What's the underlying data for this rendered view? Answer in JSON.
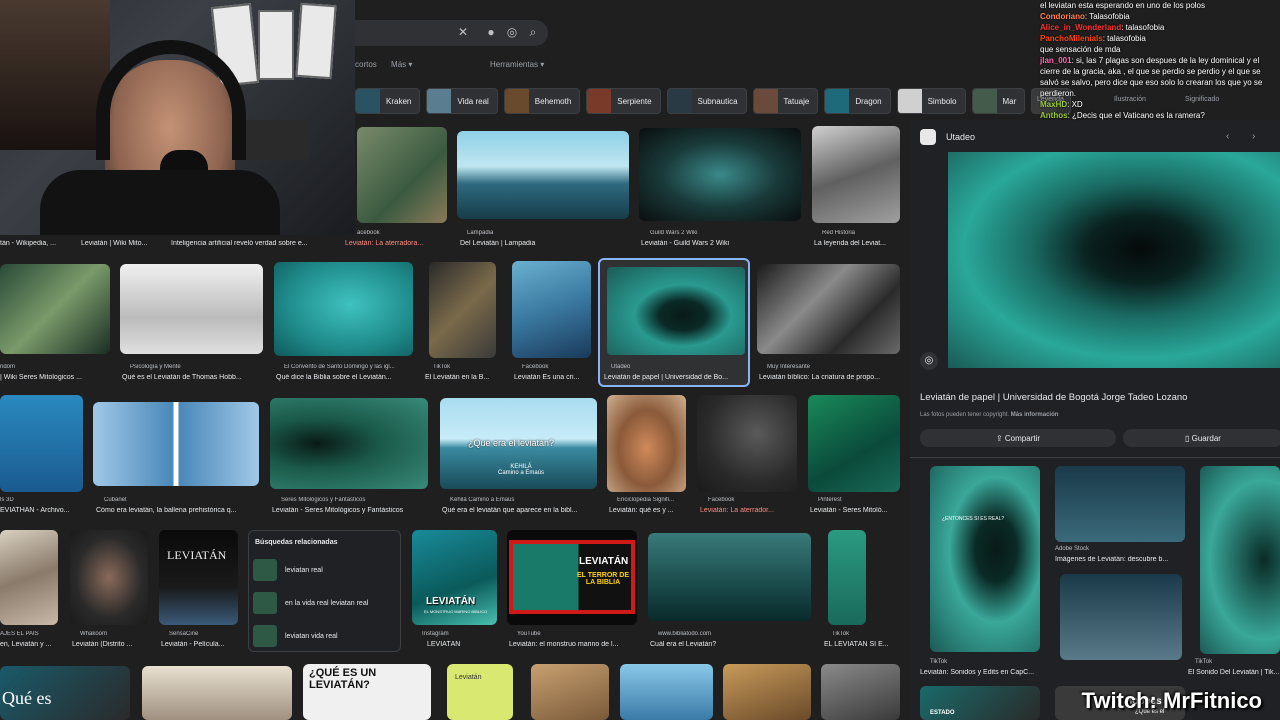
{
  "search": {
    "tabs": [
      "cortos",
      "Más ▾"
    ],
    "tools": "Herramientas ▾"
  },
  "chips": [
    "Kraken",
    "Vida real",
    "Behemoth",
    "Serpiente",
    "Subnautica",
    "Tatuaje",
    "Dragon",
    "Simbolo",
    "Mar"
  ],
  "chip_colors": [
    "#2b5260",
    "#5b7d90",
    "#6a4a2c",
    "#7a3a2a",
    "#2a3a44",
    "#6a4a3a",
    "#1f6a7a",
    "#d0d0d0",
    "#445a4a"
  ],
  "row1": [
    {
      "src": "acebook",
      "title": "Leviatán: La aterradora..."
    },
    {
      "src": "Lampadia",
      "title": "Del Leviatán | Lampadia"
    },
    {
      "src": "Guild Wars 2 Wiki",
      "title": "Leviatán - Guild Wars 2 Wiki"
    },
    {
      "src": "Red Historia",
      "title": "La leyenda del Leviat..."
    },
    {
      "src": "",
      "title": "tán - Wikipedia, ..."
    },
    {
      "src": "",
      "title": "Leviatán | Wiki Mito..."
    },
    {
      "src": "",
      "title": "Inteligencia artificial reveló verdad sobre e..."
    }
  ],
  "row2": [
    {
      "src": "ndom",
      "title": "| Wiki Seres Mitologicos ..."
    },
    {
      "src": "Psicología y Mente",
      "title": "Qué es el Leviatán de Thomas Hobb..."
    },
    {
      "src": "El Convento de Santo Domingo y las igl...",
      "title": "Qué dice la Biblia sobre el Leviatán..."
    },
    {
      "src": "TikTok",
      "title": "El Leviatán en la B..."
    },
    {
      "src": "Facebook",
      "title": "Leviatán Es una cri..."
    },
    {
      "src": "Utadeo",
      "title": "Leviatán de papel | Universidad de Bo..."
    },
    {
      "src": "Muy Interesante",
      "title": "Leviatán bíblico: La criatura de propo..."
    }
  ],
  "row3": [
    {
      "src": "ls 3D",
      "title": "EVIATHAN - Archivo..."
    },
    {
      "src": "Cubanet",
      "title": "Cómo era leviatán, la ballena prehistórica q..."
    },
    {
      "src": "Seres Mitológicos y Fantásticos",
      "title": "Leviatán - Seres Mitológicos y Fantásticos"
    },
    {
      "src": "Kehilá Camino a Emaús",
      "title": "Qué era el leviatán que aparece en la bibl..."
    },
    {
      "src": "Enciclopedia Signifi...",
      "title": "Leviatán: qué es y ..."
    },
    {
      "src": "Facebook",
      "title": "Leviatán: La aterrador..."
    },
    {
      "src": "Pinterest",
      "title": "Leviatán - Seres Mitoló..."
    }
  ],
  "row4": [
    {
      "src": "AJES EL PAIS",
      "title": "en, Leviatán y ..."
    },
    {
      "src": "Whakoom",
      "title": "Leviatán (Distrito ..."
    },
    {
      "src": "SensaCine",
      "title": "Leviatán - Película..."
    },
    {
      "src": "Instagram",
      "title": "LEVIATÁN"
    },
    {
      "src": "YouTube",
      "title": "Leviatán: el monstruo marino de l..."
    },
    {
      "src": "www.bibliatodo.com",
      "title": "Cuál era el Leviatán?"
    },
    {
      "src": "TikTok",
      "title": "EL LEVIATÁN SÍ E..."
    }
  ],
  "overlay_text": {
    "que_era": "¿Que era el leviatán?",
    "kehila": "KEHILÁ\nCamino a Emaús",
    "leviatan_poster": "LEVIATÁN",
    "leviatan_green": "LEVIATÁN",
    "el_monstruo": "EL MONSTRUO MARINO BÍBLICO",
    "red_title": "LEVIATÁN",
    "red_sub": "EL TERROR DE LA BIBLIA",
    "que_es_bottom": "¿QUÉ ES UN LEVIATÁN?",
    "que_es_left": "Qué es",
    "leviatan_book": "Leviatán",
    "entonces": "¿ENTONCES SI ES REAL?",
    "hobbes": "Hobbes",
    "hobbes_sub": "¿Qué es el",
    "estado": "ESTADO"
  },
  "related": {
    "title": "Búsquedas relacionadas",
    "items": [
      "leviatan real",
      "en la vida real leviatan real",
      "leviatan vida real"
    ]
  },
  "panel": {
    "source": "Utadeo",
    "title": "Leviatán de papel | Universidad de Bogotá Jorge Tadeo Lozano",
    "copyright": "Las fotos pueden tener copyright.",
    "more_info": "Más información",
    "share": "Compartir",
    "save": "Guardar",
    "sim1_src": "Adobe Stock",
    "sim1_title": "Imágenes de Leviatán: descubre b...",
    "sim2_src": "TikTok",
    "sim2_title": "Leviatán: Sonidos y Edits en CapC...",
    "sim3_src": "TikTok",
    "sim3_title": "El Sonido Del Leviatán | Tik..."
  },
  "panel_tabs": [
    "Leyenda",
    "Ilustración",
    "Significado"
  ],
  "chat": [
    {
      "user": "",
      "color": "#8a5cf5",
      "text": "el leviatan esta esperando en uno de los polos"
    },
    {
      "user": "Condoriano",
      "color": "#ff7f50",
      "text": "Talasofobia"
    },
    {
      "user": "Alice_in_Wonderland",
      "color": "#ff2f2f",
      "text": "talasofobia"
    },
    {
      "user": "PanchoMilenials",
      "color": "#ff4500",
      "text": "talasofobia"
    },
    {
      "user": "",
      "color": "#1e90ff",
      "text": "que sensación de mda"
    },
    {
      "user": "jlan_001",
      "color": "#ff69b4",
      "text": "si, las 7 plagas son despues de la ley dominical y el cierre de la gracia, aka , el que se perdio se perdio y el que se salvó se salvo, pero dice que eso solo lo crearan los que yo se perdieron."
    },
    {
      "user": "MaxHD",
      "color": "#9acd32",
      "text": "XD"
    },
    {
      "user": "Anthos",
      "color": "#9acd32",
      "text": "¿Decis que el Vaticano es la ramera?"
    }
  ],
  "overlay": {
    "twitch": "Twitch: MrFitnico"
  }
}
